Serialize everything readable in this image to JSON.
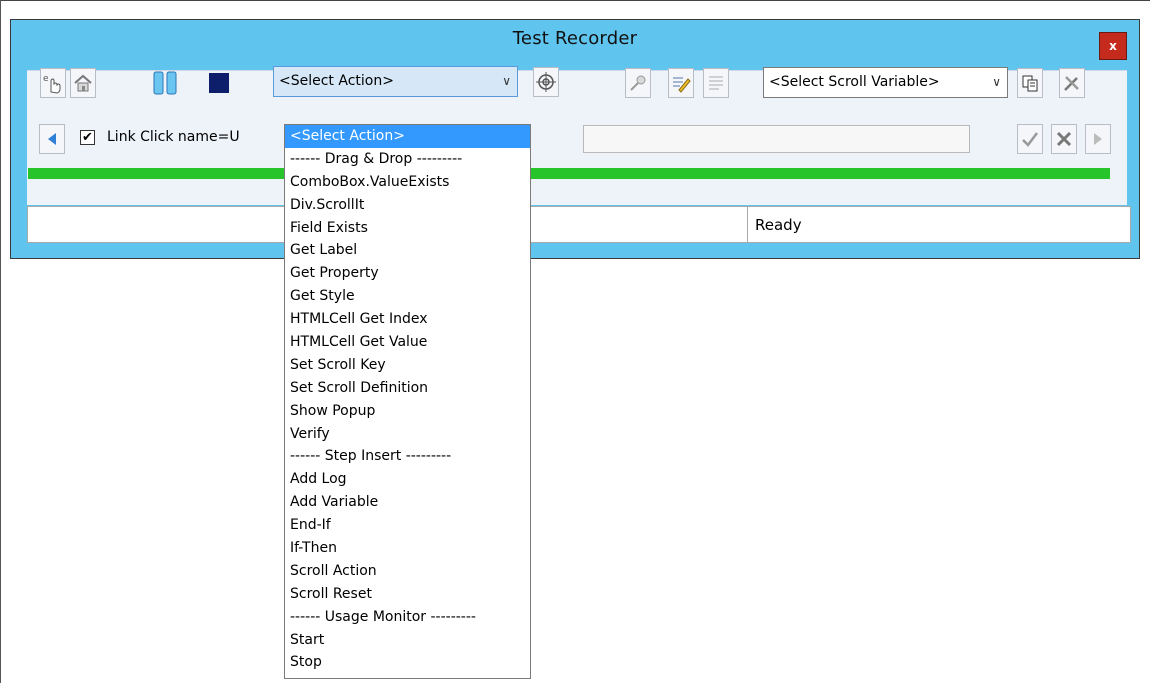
{
  "window": {
    "title": "Test Recorder",
    "close_label": "x"
  },
  "toolbar": {
    "action_select": {
      "value": "<Select Action>",
      "chevron": "∨"
    },
    "scroll_select": {
      "value": "<Select Scroll Variable>",
      "chevron": "∨"
    }
  },
  "step": {
    "checkbox_mark": "✔",
    "label": "Link Click name=U",
    "checked": true
  },
  "status": {
    "text": "Ready"
  },
  "progress": {
    "fraction": 1.0,
    "color": "#27c42b"
  },
  "colors": {
    "window_frame": "#60c5ee",
    "dropdown_highlight": "#3399ff",
    "close_button": "#c42b1c"
  },
  "dropdown": {
    "items": [
      "<Select Action>",
      "------ Drag & Drop ---------",
      "ComboBox.ValueExists",
      "Div.ScrollIt",
      "Field Exists",
      "Get Label",
      "Get Property",
      "Get Style",
      "HTMLCell Get Index",
      "HTMLCell Get Value",
      "Set Scroll Key",
      "Set Scroll Definition",
      "Show Popup",
      "Verify",
      "------ Step Insert ---------",
      "Add Log",
      "Add Variable",
      "End-If",
      "If-Then",
      "Scroll Action",
      "Scroll Reset",
      "------ Usage Monitor ---------",
      "Start",
      "Stop"
    ]
  },
  "icons": {
    "record_hand": "hand-pointer-icon",
    "home": "home-icon",
    "pause": "pause-icon",
    "stop": "stop-icon",
    "target": "crosshair-icon",
    "key": "key-icon",
    "edit": "edit-note-icon",
    "list": "list-icon",
    "copy": "copy-icon",
    "tools": "tools-icon",
    "back": "back-arrow-icon",
    "accept": "checkmark-icon",
    "delete": "delete-x-icon",
    "forward": "forward-arrow-icon"
  }
}
